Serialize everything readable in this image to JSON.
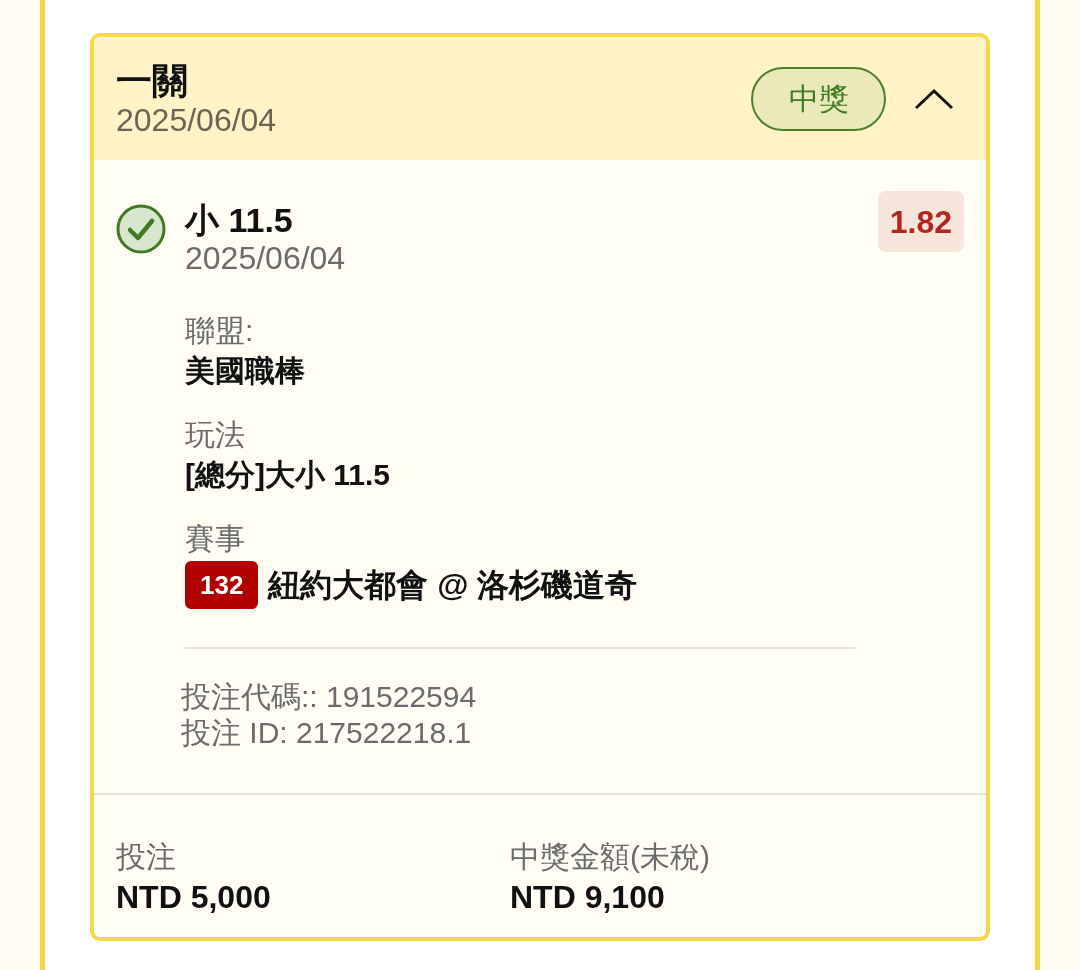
{
  "bet": {
    "type": "一關",
    "date": "2025/06/04",
    "status": {
      "label": "中獎",
      "kind": "won"
    },
    "expanded": true
  },
  "selections": [
    {
      "pick": "小 11.5",
      "date": "2025/06/04",
      "checked": true,
      "odds": "1.82",
      "details": [
        {
          "kind": "text",
          "label": "聯盟:",
          "value": "美國職棒"
        },
        {
          "kind": "text",
          "label": "玩法",
          "value": "[總分]大小 11.5"
        },
        {
          "kind": "match",
          "label": "賽事",
          "match_number": "132",
          "value": "紐約大都會 @ 洛杉磯道奇"
        }
      ],
      "codes": [
        "投注代碼:: 191522594",
        "投注 ID: 217522218.1"
      ]
    }
  ],
  "summary": [
    {
      "label": "投注",
      "value": "NTD 5,000"
    },
    {
      "label": "中獎金額(未稅)",
      "value": "NTD 9,100"
    }
  ]
}
